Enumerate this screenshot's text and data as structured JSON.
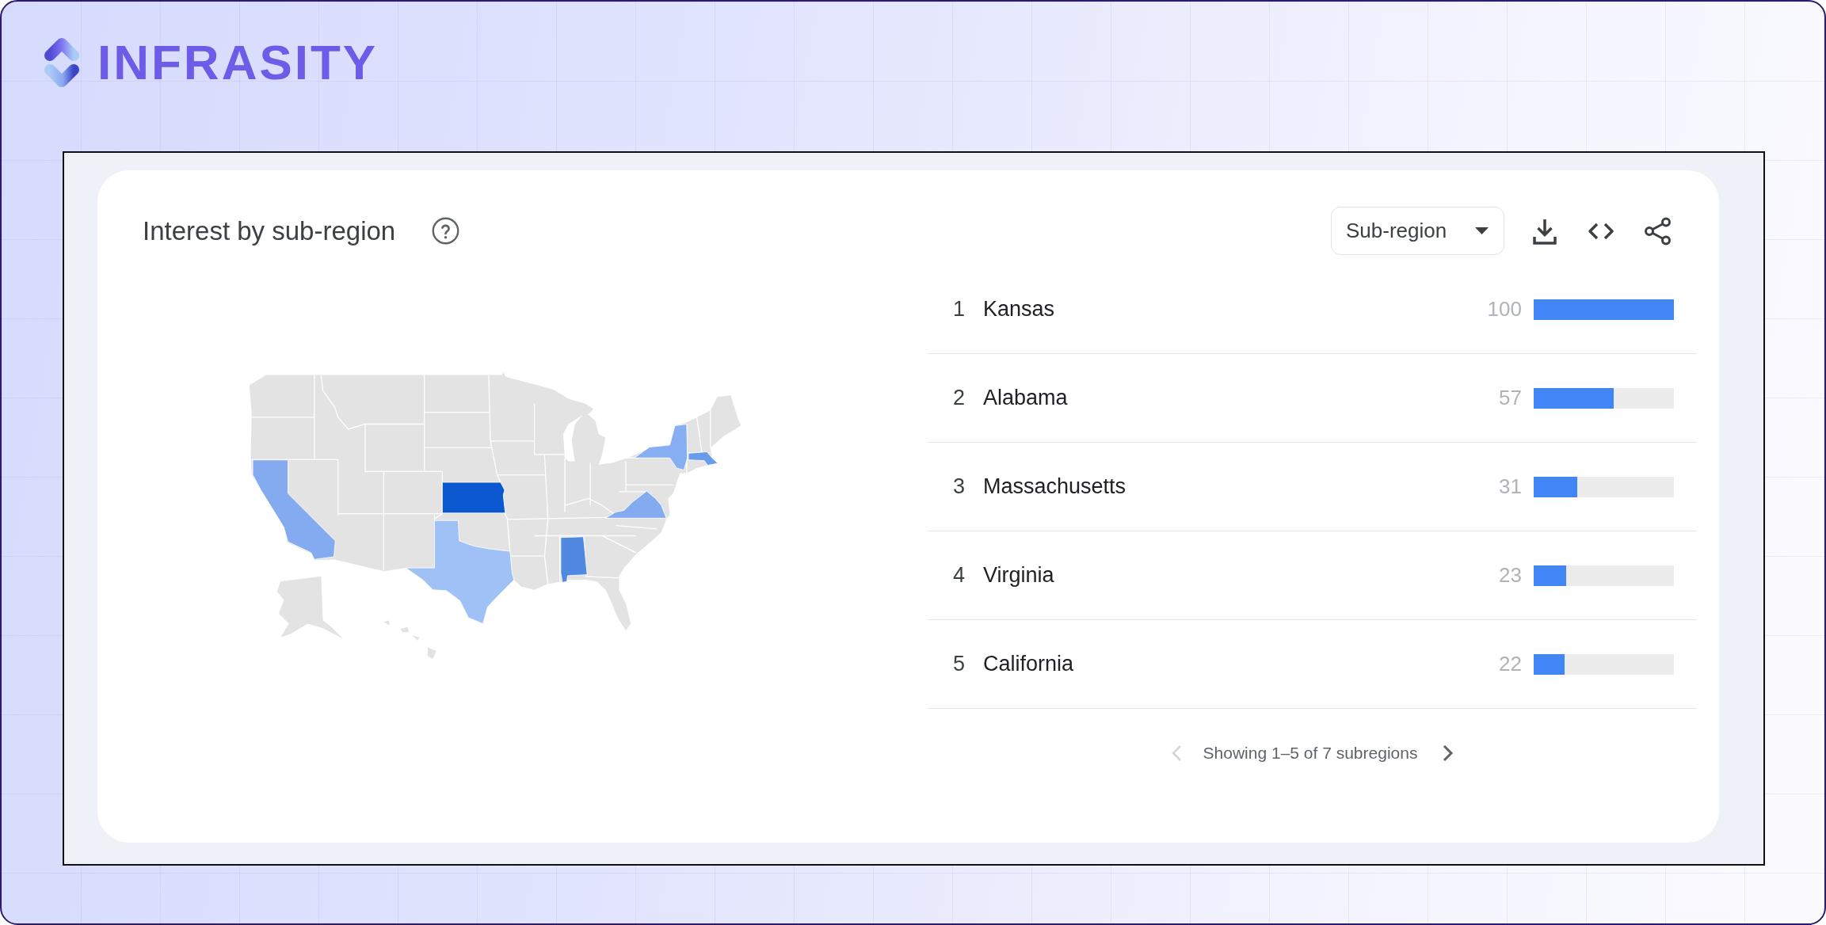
{
  "brand": {
    "name": "INFRASITY"
  },
  "panel": {
    "title": "Interest by sub-region",
    "resolution": {
      "value": "Sub-region"
    },
    "map": {
      "regions": [
        {
          "kind": "kansas",
          "color": "#0b57d0"
        },
        {
          "kind": "alabama",
          "color": "#5088e2"
        },
        {
          "kind": "massachusetts",
          "color": "#6a9cec"
        },
        {
          "kind": "virginia",
          "color": "#84abf0"
        },
        {
          "kind": "california",
          "color": "#84abf0"
        },
        {
          "kind": "newyork",
          "color": "#87aef1"
        },
        {
          "kind": "texas",
          "color": "#a0c1f6"
        }
      ]
    },
    "ranking": [
      {
        "rank": "1",
        "name": "Kansas",
        "value": "100",
        "level": 1
      },
      {
        "rank": "2",
        "name": "Alabama",
        "value": "57",
        "level": 0.57
      },
      {
        "rank": "3",
        "name": "Massachusetts",
        "value": "31",
        "level": 0.31
      },
      {
        "rank": "4",
        "name": "Virginia",
        "value": "23",
        "level": 0.23
      },
      {
        "rank": "5",
        "name": "California",
        "value": "22",
        "level": 0.22
      }
    ],
    "pagination": {
      "text": "Showing 1–5 of 7 subregions",
      "previous": {
        "disabled": true
      },
      "next": {
        "disabled": false
      }
    }
  }
}
